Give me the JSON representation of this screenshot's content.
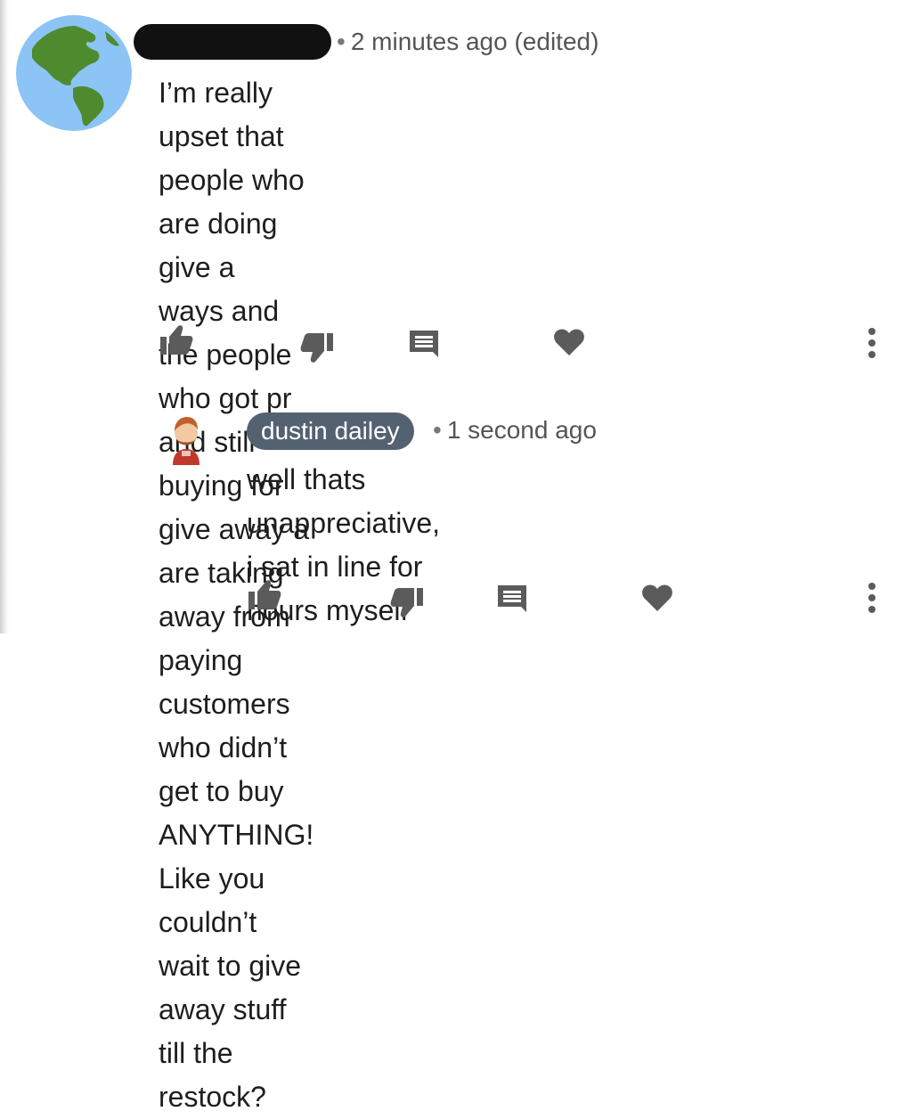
{
  "comments": [
    {
      "author": "",
      "author_redacted": true,
      "timestamp": "2 minutes ago (edited)",
      "text_lines": [
        "I’m really upset that people who are doing give a",
        "ways and the people who got pr and still buying for",
        "give away a are taking away from paying customers",
        "who didn’t get to buy ANYTHING! Like you couldn’t",
        "wait to give away stuff till the restock?"
      ],
      "avatar_icon": "globe-americas-icon"
    }
  ],
  "reply": {
    "author": "dustin dailey",
    "timestamp": "1 second ago",
    "text_lines": [
      "well thats unappreciative, i sat in line for",
      "hours myself"
    ],
    "avatar_icon": "user-avatar-icon"
  },
  "separator_dot": "•",
  "actions": [
    "thumbs-up-icon",
    "thumbs-down-icon",
    "reply-icon",
    "heart-icon",
    "more-vert-icon"
  ],
  "colors": {
    "icon_gray": "#5b5b5b",
    "author_pill_bg": "#546170",
    "globe_ocean": "#8cc4f5",
    "globe_land": "#4e8b2f"
  }
}
